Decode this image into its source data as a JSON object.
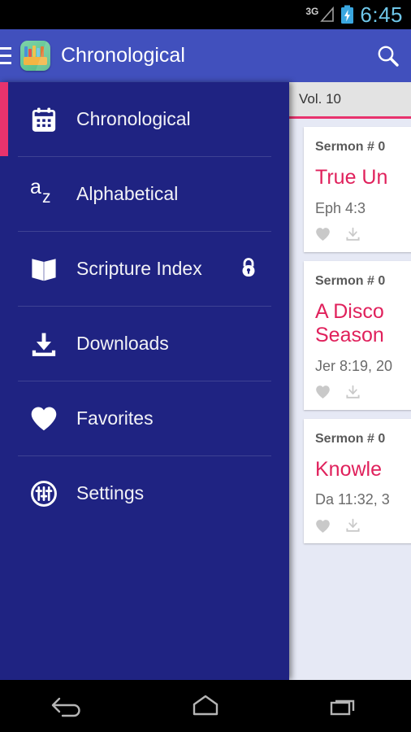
{
  "status_bar": {
    "network_label": "3G",
    "time": "6:45",
    "icons": [
      "signal-triangle-icon",
      "battery-charging-icon"
    ],
    "time_color": "#6ec6e8"
  },
  "action_bar": {
    "menu_icon": "hamburger-menu-icon",
    "app_icon": "bookshelf-app-icon",
    "title": "Chronological",
    "search_icon": "search-icon",
    "background_color": "#4150bd"
  },
  "drawer": {
    "background_color": "#1f2382",
    "selection_color": "#e8336d",
    "items": [
      {
        "label": "Chronological",
        "icon": "calendar-icon",
        "selected": true,
        "locked": false
      },
      {
        "label": "Alphabetical",
        "icon": "a-z-sort-icon",
        "selected": false,
        "locked": false
      },
      {
        "label": "Scripture Index",
        "icon": "open-book-icon",
        "selected": false,
        "locked": true
      },
      {
        "label": "Downloads",
        "icon": "download-icon",
        "selected": false,
        "locked": false
      },
      {
        "label": "Favorites",
        "icon": "heart-icon",
        "selected": false,
        "locked": false
      },
      {
        "label": "Settings",
        "icon": "settings-sliders-icon",
        "selected": false,
        "locked": false
      }
    ],
    "lock_icon": "padlock-icon"
  },
  "content": {
    "tab": {
      "label": "Vol. 10",
      "underline_color": "#e8336d"
    },
    "accent_color": "#e0215c",
    "cards": [
      {
        "sermon": "Sermon # 0",
        "title": "True Un",
        "reference": "Eph 4:3",
        "favorite_icon": "heart-icon",
        "download_icon": "download-icon"
      },
      {
        "sermon": "Sermon # 0",
        "title": "A Disco\nSeason",
        "reference": "Jer 8:19, 20",
        "favorite_icon": "heart-icon",
        "download_icon": "download-icon"
      },
      {
        "sermon": "Sermon # 0",
        "title": "Knowle",
        "reference": "Da 11:32, 3",
        "favorite_icon": "heart-icon",
        "download_icon": "download-icon"
      }
    ]
  },
  "nav_bar": {
    "buttons": [
      {
        "name": "back-button",
        "icon": "back-arrow-icon"
      },
      {
        "name": "home-button",
        "icon": "home-icon"
      },
      {
        "name": "recents-button",
        "icon": "recents-icon"
      }
    ]
  }
}
